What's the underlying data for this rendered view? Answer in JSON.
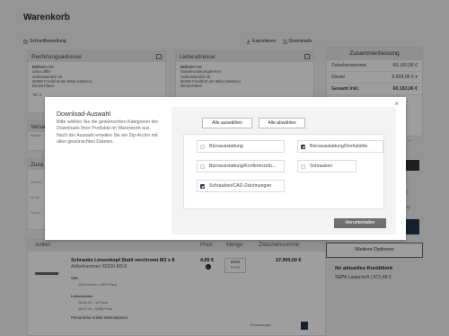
{
  "page": {
    "title": "Warenkorb",
    "quick_order": "Schnellbestellung",
    "export": "Exportieren",
    "downloads": "Downloads"
  },
  "billing": {
    "title": "Rechnungsadresse",
    "lines": [
      "Beltheim AG",
      "Lisa Löffler",
      "Schlossstraße 36",
      "60486 Frankfurt am Main (Hessen)",
      "Deutschland"
    ],
    "phone": "Tel. 0"
  },
  "shipping": {
    "title": "Lieferadresse",
    "lines": [
      "Beltheim AG",
      "Susanne Baumgaertner",
      "Schlossstraße 36",
      "60486 Frankfurt am Main (Hessen)",
      "Deutschland"
    ]
  },
  "left_cards": {
    "shipping_method": "Versa",
    "shipping_line": "Standa",
    "additional": "Zusa",
    "add_lines": [
      "Ihre Ko",
      "Ihr Zei",
      "Comm"
    ]
  },
  "summary": {
    "title": "Zusammenfassung",
    "rows": [
      {
        "label": "Zwischensumme",
        "value": "60.183,06 €"
      },
      {
        "label": "Steuer",
        "value": "9.609,06 € ▾"
      },
      {
        "label": "Gesamt inkl.",
        "value": "60.183,06 €"
      }
    ]
  },
  "side_hints": {
    "right_a": "l",
    "right_b": "ip"
  },
  "items": {
    "headers": {
      "article": "Artikel",
      "price": "Preis",
      "quantity": "Menge",
      "subtotal": "Zwischensumme"
    },
    "row": {
      "name": "Schraube Linsenkopf Stahl verchromt M3 x 8",
      "article_no": "Artikelnummer: 60230-M3-8",
      "price": "4,65 €",
      "qty": "6000",
      "qty_unit": "Pack",
      "total": "27.900,00 €",
      "info_icon": "i",
      "vpe_label": "VPE",
      "vpe_value": "1000 Karton = 6000 Pack",
      "delivery_label": "Liefertermine",
      "delivery_1": "28.08.24  –  14 Pack",
      "delivery_2": "18.07.24  –  5.986 Pack",
      "personal": "Persönliche Artikel-Informationen",
      "remember": "Erinnerungen"
    }
  },
  "right_lower": {
    "more_options": "Weitere Optionen",
    "credit_title": "Ihr aktuelles Kreditlimit",
    "credit_line": "SEPA Lastschrift | 972,48 €"
  },
  "modal": {
    "title": "Download-Auswahl",
    "description": "Bitte wählen Sie die gewünschten Kategorien der Downloads Ihrer Produkte im Warenkorb aus. Nach der Auswahl erhalten Sie ein Zip-Archiv mit allen gewünschten Dateien.",
    "close_icon": "×",
    "select_all": "Alle auswählen",
    "deselect_all": "Alle abwählen",
    "options": [
      {
        "label": "Büroausstattung",
        "checked": false
      },
      {
        "label": "Büroausstattung/Drehstühle",
        "checked": true
      },
      {
        "label": "Büroausstattung/Konferenzstü...",
        "checked": false
      },
      {
        "label": "Schrauben",
        "checked": false
      },
      {
        "label": "Schrauben/CAD-Zeichnungen",
        "checked": true
      }
    ],
    "download": "Herunterladen"
  },
  "colors": {
    "accent_navy": "#1f3552",
    "download_button": "#6f7072",
    "overlay": "rgba(0,0,0,0.38)"
  }
}
